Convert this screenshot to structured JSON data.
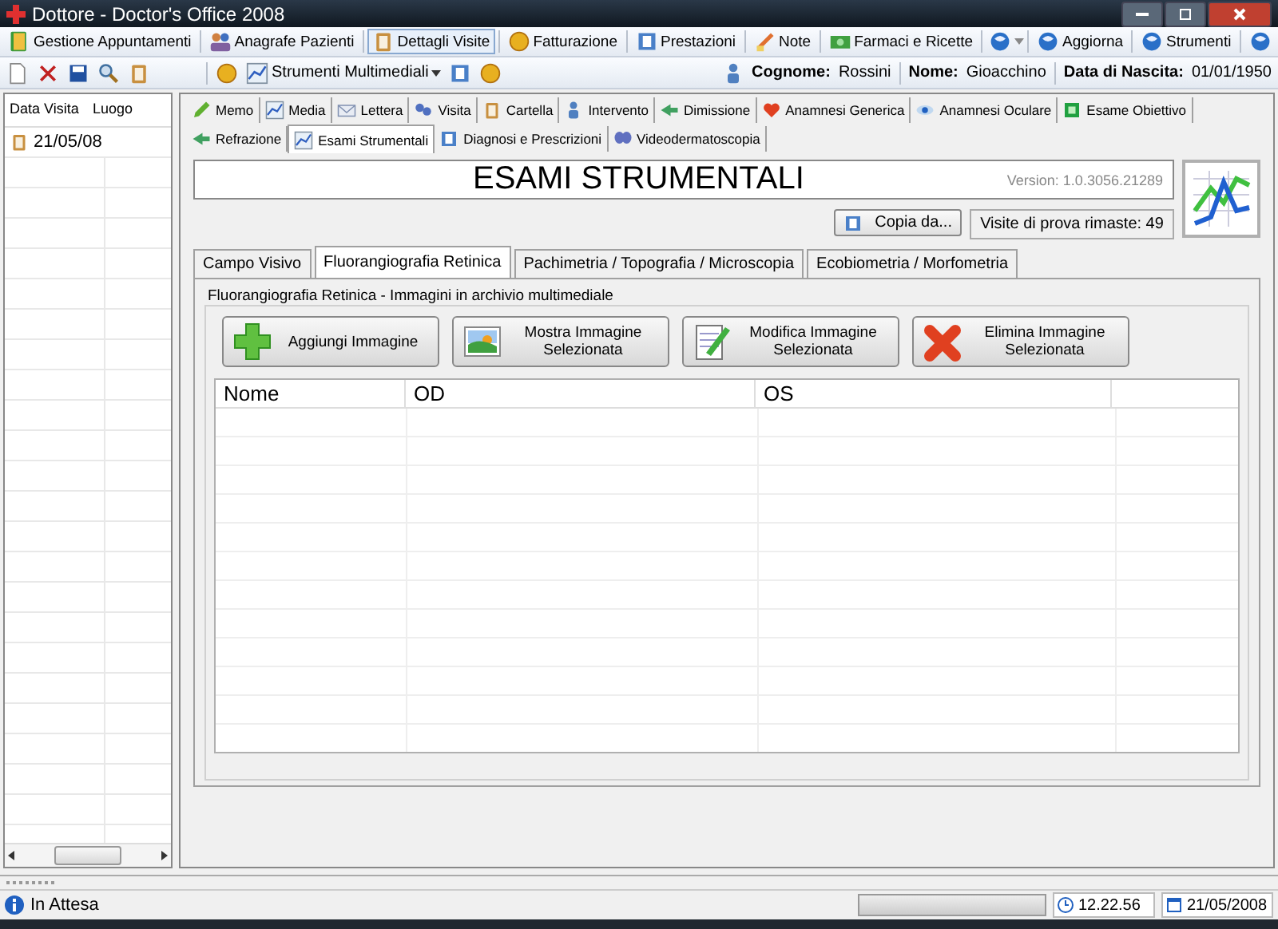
{
  "window": {
    "title": "Dottore - Doctor's Office 2008"
  },
  "menu_bar": {
    "items": [
      {
        "label": "Gestione Appuntamenti",
        "selected": false
      },
      {
        "label": "Anagrafe Pazienti",
        "selected": false
      },
      {
        "label": "Dettagli Visite",
        "selected": true
      },
      {
        "label": "Fatturazione",
        "selected": false
      },
      {
        "label": "Prestazioni",
        "selected": false
      },
      {
        "label": "Note",
        "selected": false
      },
      {
        "label": "Farmaci e Ricette",
        "selected": false
      }
    ],
    "right_items": [
      {
        "label": "Aggiorna"
      },
      {
        "label": "Strumenti"
      }
    ]
  },
  "toolbar": {
    "media_button": "Strumenti Multimediali",
    "patient": [
      {
        "label": "Cognome:",
        "value": "Rossini"
      },
      {
        "label": "Nome:",
        "value": "Gioacchino"
      },
      {
        "label": "Data di Nascita:",
        "value": "01/01/1950"
      }
    ]
  },
  "sidebar": {
    "columns": [
      "Data Visita",
      "Luogo"
    ],
    "rows": [
      {
        "date": "21/05/08"
      }
    ]
  },
  "tab_rows": [
    {
      "tabs": [
        {
          "label": "Memo",
          "selected": false
        },
        {
          "label": "Media",
          "selected": false
        },
        {
          "label": "Lettera",
          "selected": false
        },
        {
          "label": "Visita",
          "selected": false
        },
        {
          "label": "Cartella",
          "selected": false
        },
        {
          "label": "Intervento",
          "selected": false
        },
        {
          "label": "Dimissione",
          "selected": false
        },
        {
          "label": "Anamnesi Generica",
          "selected": false
        },
        {
          "label": "Anamnesi Oculare",
          "selected": false
        },
        {
          "label": "Esame Obiettivo",
          "selected": false
        }
      ]
    },
    {
      "tabs": [
        {
          "label": "Refrazione",
          "selected": false
        },
        {
          "label": "Esami Strumentali",
          "selected": true
        },
        {
          "label": "Diagnosi e Prescrizioni",
          "selected": false
        },
        {
          "label": "Videodermatoscopia",
          "selected": false
        }
      ]
    }
  ],
  "header": {
    "title": "ESAMI STRUMENTALI",
    "version": "Version: 1.0.3056.21289",
    "copy_button": "Copia da...",
    "trial_label": "Visite di prova rimaste: 49"
  },
  "subtabs": [
    {
      "label": "Campo Visivo",
      "selected": false
    },
    {
      "label": "Fluorangiografia Retinica",
      "selected": true
    },
    {
      "label": "Pachimetria / Topografia / Microscopia",
      "selected": false
    },
    {
      "label": "Ecobiometria / Morfometria",
      "selected": false
    }
  ],
  "group": {
    "legend": "Fluorangiografia Retinica - Immagini in archivio multimediale",
    "buttons": [
      {
        "label": "Aggiungi Immagine"
      },
      {
        "label": "Mostra Immagine Selezionata"
      },
      {
        "label": "Modifica Immagine Selezionata"
      },
      {
        "label": "Elimina Immagine Selezionata"
      }
    ],
    "table": {
      "columns": [
        "Nome",
        "OD",
        "OS"
      ]
    }
  },
  "status_bar": {
    "status": "In Attesa",
    "progress": {
      "level": 0
    },
    "time": "12.22.56",
    "date": "21/05/2008"
  }
}
